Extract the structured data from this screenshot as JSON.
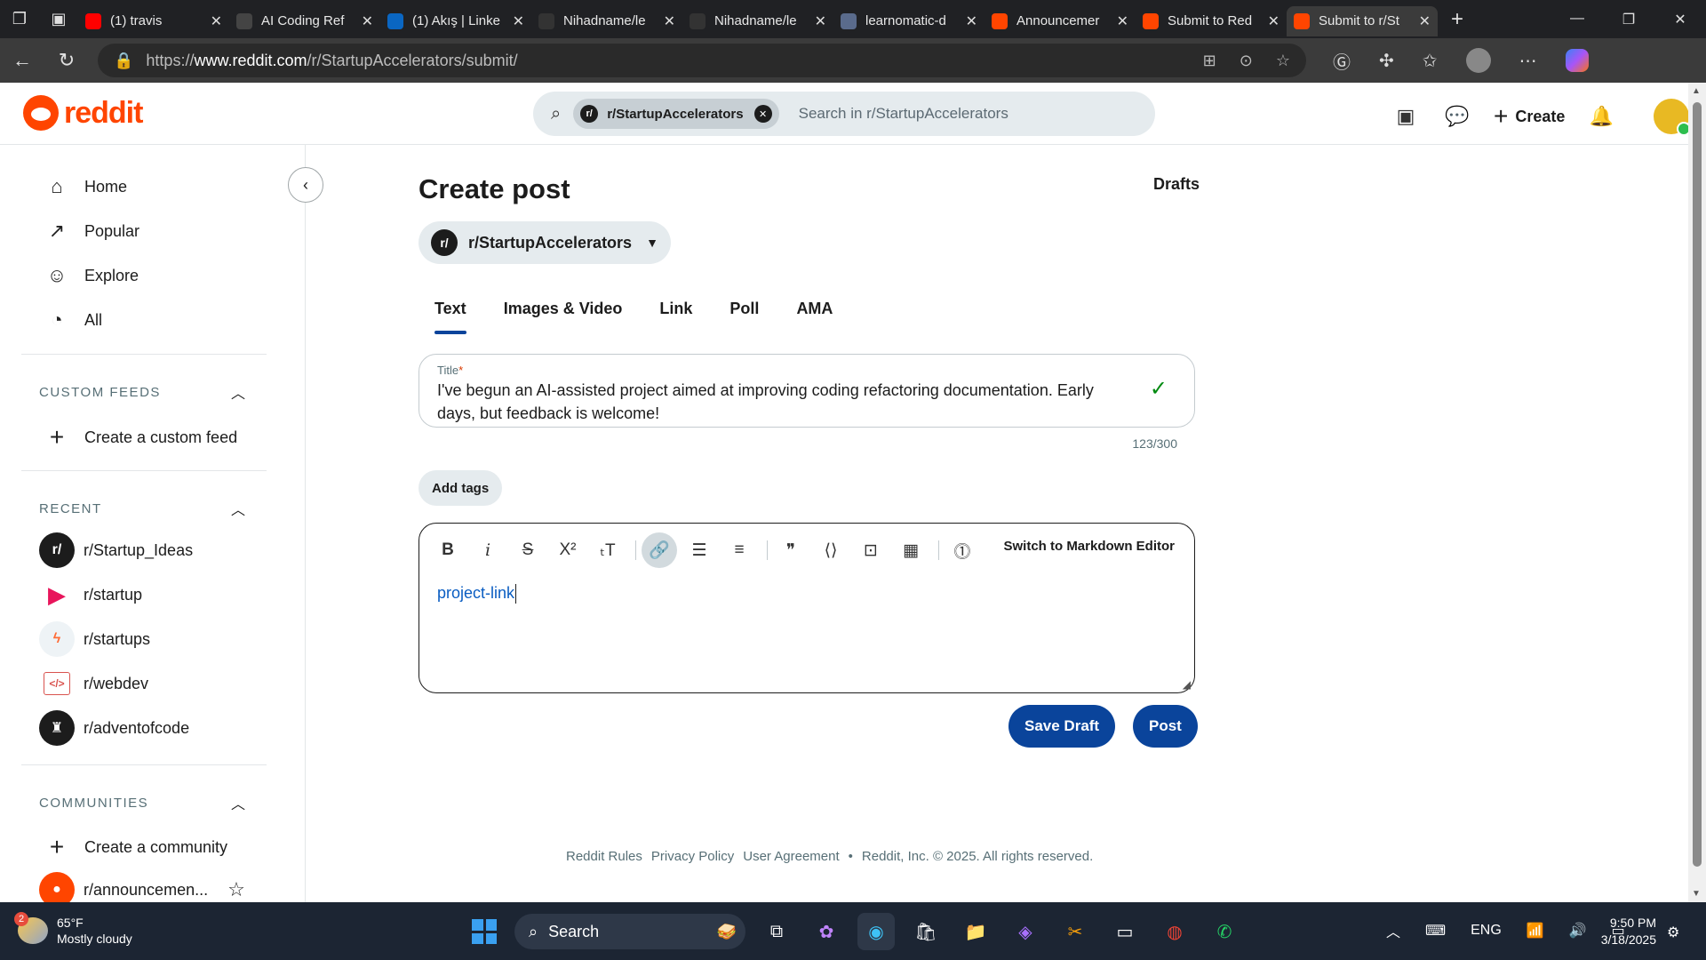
{
  "browser": {
    "tabs": [
      {
        "title": "(1) travis",
        "favicon_color": "#ff0000",
        "icon": "youtube-icon"
      },
      {
        "title": "AI Coding Ref",
        "favicon_color": "#444444",
        "icon": "openai-icon"
      },
      {
        "title": "(1) Akış | Linke",
        "favicon_color": "#0a66c2",
        "icon": "linkedin-icon"
      },
      {
        "title": "Nihadname/le",
        "favicon_color": "#333333",
        "icon": "github-icon"
      },
      {
        "title": "Nihadname/le",
        "favicon_color": "#333333",
        "icon": "github-icon"
      },
      {
        "title": "learnomatic-d",
        "favicon_color": "#5a6b8c",
        "icon": "page-icon"
      },
      {
        "title": "Announcemer",
        "favicon_color": "#ff4500",
        "icon": "reddit-icon"
      },
      {
        "title": "Submit to Red",
        "favicon_color": "#ff4500",
        "icon": "reddit-icon"
      },
      {
        "title": "Submit to r/St",
        "favicon_color": "#ff4500",
        "icon": "reddit-icon",
        "active": true
      }
    ],
    "url_prefix": "https://",
    "url_host": "www.reddit.com",
    "url_path": "/r/StartupAccelerators/submit/"
  },
  "header": {
    "logo_text": "reddit",
    "search_chip": "r/StartupAccelerators",
    "search_placeholder": "Search in r/StartupAccelerators",
    "create_label": "Create"
  },
  "sidebar": {
    "nav": [
      {
        "label": "Home",
        "icon": "home-icon"
      },
      {
        "label": "Popular",
        "icon": "popular-icon"
      },
      {
        "label": "Explore",
        "icon": "explore-icon"
      },
      {
        "label": "All",
        "icon": "all-icon"
      }
    ],
    "custom_feeds_title": "CUSTOM FEEDS",
    "create_custom_feed": "Create a custom feed",
    "recent_title": "RECENT",
    "recent": [
      {
        "label": "r/Startup_Ideas",
        "color": "#1c1c1c",
        "glyph": "r/"
      },
      {
        "label": "r/startup",
        "color": "#ffffff",
        "glyph": "▶"
      },
      {
        "label": "r/startups",
        "color": "#eef3f6",
        "glyph": "ϟ"
      },
      {
        "label": "r/webdev",
        "color": "#ffffff",
        "glyph": "</>"
      },
      {
        "label": "r/adventofcode",
        "color": "#1c1c1c",
        "glyph": "♜"
      }
    ],
    "communities_title": "COMMUNITIES",
    "create_community": "Create a community",
    "communities": [
      {
        "label": "r/announcemen...",
        "color": "#ff4500"
      }
    ]
  },
  "main": {
    "title": "Create post",
    "drafts": "Drafts",
    "selected_sub": "r/StartupAccelerators",
    "tabs": [
      "Text",
      "Images & Video",
      "Link",
      "Poll",
      "AMA"
    ],
    "title_label": "Title",
    "title_required": "*",
    "title_value": "I've begun an AI-assisted project aimed at improving coding refactoring documentation. Early days, but feedback is welcome!",
    "char_count": "123/300",
    "add_tags": "Add tags",
    "md_switch": "Switch to Markdown Editor",
    "body_text": "project-link",
    "save_draft": "Save Draft",
    "post": "Post"
  },
  "footer": {
    "links": [
      "Reddit Rules",
      "Privacy Policy",
      "User Agreement",
      "•",
      "Reddit, Inc. © 2025. All rights reserved."
    ]
  },
  "taskbar": {
    "weather_temp": "65°F",
    "weather_desc": "Mostly cloudy",
    "weather_badge": "2",
    "search_label": "Search",
    "lang": "ENG",
    "time": "9:50 PM",
    "date": "3/18/2025"
  }
}
